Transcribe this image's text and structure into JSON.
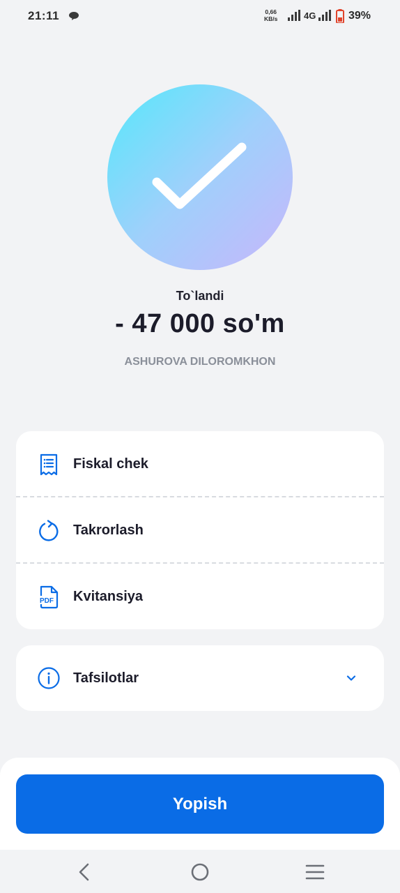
{
  "status_bar": {
    "time": "21:11",
    "speed_value": "0,66",
    "speed_unit": "KB/s",
    "network": "4G",
    "battery": "39%"
  },
  "result": {
    "status": "To`landi",
    "amount": "- 47 000 so'm",
    "recipient": "ASHUROVA DILOROMKHON"
  },
  "actions": [
    {
      "label": "Fiskal chek",
      "icon": "receipt-icon"
    },
    {
      "label": "Takrorlash",
      "icon": "repeat-icon"
    },
    {
      "label": "Kvitansiya",
      "icon": "pdf-icon",
      "icon_text": "PDF"
    }
  ],
  "details": {
    "label": "Tafsilotlar",
    "icon": "info-icon"
  },
  "close_button": {
    "label": "Yopish"
  },
  "colors": {
    "accent": "#0a6ce6",
    "background": "#f2f3f5",
    "card": "#ffffff"
  }
}
